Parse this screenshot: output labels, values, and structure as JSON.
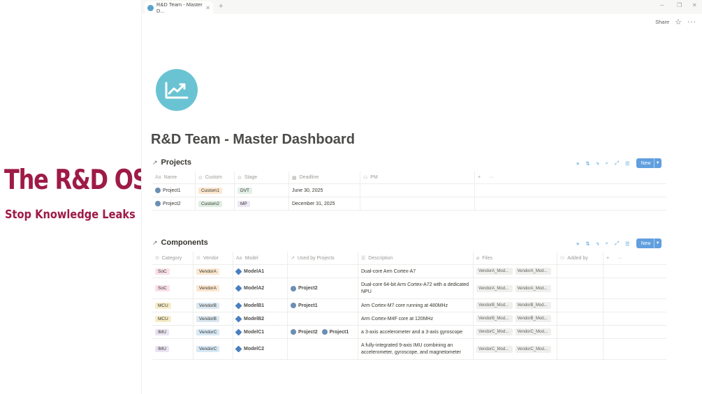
{
  "promo": {
    "title": "The R&D OS",
    "subtitle": "Stop Knowledge Leaks"
  },
  "browser": {
    "tab_title": "R&D Team - Master D...",
    "share_label": "Share"
  },
  "page": {
    "title": "R&D Team - Master Dashboard",
    "icon": "trend-chart-icon"
  },
  "projects": {
    "title": "Projects",
    "new_label": "New",
    "columns": [
      "Name",
      "Custom",
      "Stage",
      "Deadline",
      "PM"
    ],
    "rows": [
      {
        "name": "Project1",
        "custom": "Custom1",
        "stage": "DVT",
        "deadline": "June 30, 2025"
      },
      {
        "name": "Project2",
        "custom": "Custom2",
        "stage": "MP",
        "deadline": "December 31, 2025"
      }
    ]
  },
  "components": {
    "title": "Components",
    "new_label": "New",
    "columns": [
      "Category",
      "Vendor",
      "Model",
      "Used by Projects",
      "Description",
      "Files",
      "Added by"
    ],
    "rows": [
      {
        "category": "SoC",
        "vendor": "VendorA",
        "model": "ModelA1",
        "projects": [],
        "description": "Dual-core Arm Cortex-A7",
        "files": [
          "VendorA_Mod...",
          "VendorA_Mod..."
        ]
      },
      {
        "category": "SoC",
        "vendor": "VendorA",
        "model": "ModelA2",
        "projects": [
          "Project2"
        ],
        "description": "Dual-core 64-bit Arm Cortex-A72 with a dedicated NPU",
        "files": [
          "VendorA_Mod...",
          "VendorA_Mod..."
        ]
      },
      {
        "category": "MCU",
        "vendor": "VendorB",
        "model": "ModelB1",
        "projects": [
          "Project1"
        ],
        "description": "Arm Cortex-M7 core running at 480MHz",
        "files": [
          "VendorB_Mod...",
          "VendorB_Mod..."
        ]
      },
      {
        "category": "MCU",
        "vendor": "VendorB",
        "model": "ModelB2",
        "projects": [],
        "description": "Arm Cortex-M4F core at 120MHz",
        "files": [
          "VendorB_Mod...",
          "VendorB_Mod..."
        ]
      },
      {
        "category": "IMU",
        "vendor": "VendorC",
        "model": "ModelC1",
        "projects": [
          "Project2",
          "Project1"
        ],
        "description": "a 3-axis accelerometer and a 3-axis gyroscope",
        "files": [
          "VendorC_Mod...",
          "VendorC_Mod..."
        ]
      },
      {
        "category": "IMU",
        "vendor": "VendorC",
        "model": "ModelC2",
        "projects": [],
        "description": "A fully-integrated 9-axis IMU combining an accelerometer, gyroscope, and magnetometer",
        "files": [
          "VendorC_Mod...",
          "VendorC_Mod..."
        ]
      }
    ]
  },
  "colors": {
    "promo_text": "#9e1a47",
    "page_icon": "#6ac3d3",
    "new_button": "#2d7fd3",
    "tag_soc": "#f9e1e8",
    "tag_mcu": "#f6edc9",
    "tag_imu": "#ebe3f3",
    "tag_vendor_a": "#fbe7cf",
    "tag_vendor_b": "#dbe8f2",
    "tag_vendor_c": "#d7e9f5"
  }
}
